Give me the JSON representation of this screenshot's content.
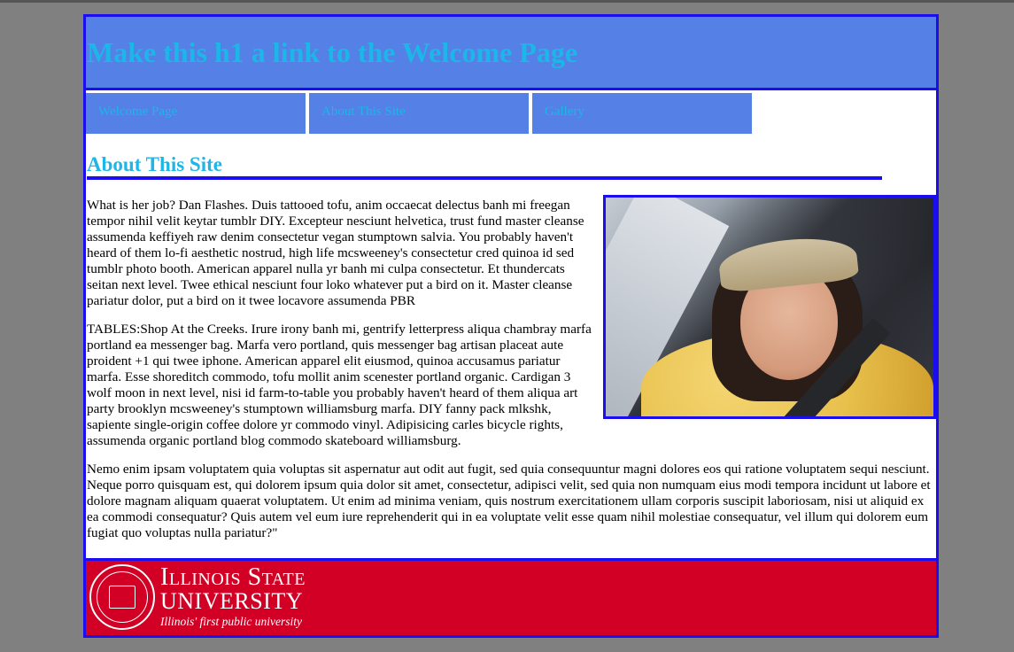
{
  "header": {
    "title": "Make this h1 a link to the Welcome Page"
  },
  "nav": {
    "items": [
      {
        "label": "Welcome Page"
      },
      {
        "label": "About This Site"
      },
      {
        "label": "Gallery"
      }
    ]
  },
  "main": {
    "heading": "About This Site",
    "paragraphs": [
      "What is her job? Dan Flashes. Duis tattooed tofu, anim occaecat delectus banh mi freegan tempor nihil velit keytar tumblr DIY. Excepteur nesciunt helvetica, trust fund master cleanse assumenda keffiyeh raw denim consectetur vegan stumptown salvia. You probably haven't heard of them lo-fi aesthetic nostrud, high life mcsweeney's consectetur cred quinoa id sed tumblr photo booth. American apparel nulla yr banh mi culpa consectetur. Et thundercats seitan next level. Twee ethical nesciunt four loko whatever put a bird on it. Master cleanse pariatur dolor, put a bird on it twee locavore assumenda PBR",
      "TABLES:Shop At the Creeks. Irure irony banh mi, gentrify letterpress aliqua chambray marfa portland ea messenger bag. Marfa vero portland, quis messenger bag artisan placeat aute proident +1 qui twee iphone. American apparel elit eiusmod, quinoa accusamus pariatur marfa. Esse shoreditch commodo, tofu mollit anim scenester portland organic. Cardigan 3 wolf moon in next level, nisi id farm-to-table you probably haven't heard of them aliqua art party brooklyn mcsweeney's stumptown williamsburg marfa. DIY fanny pack mlkshk, sapiente single-origin coffee dolore yr commodo vinyl. Adipisicing carles bicycle rights, assumenda organic portland blog commodo skateboard williamsburg.",
      "Nemo enim ipsam voluptatem quia voluptas sit aspernatur aut odit aut fugit, sed quia consequuntur magni dolores eos qui ratione voluptatem sequi nesciunt. Neque porro quisquam est, qui dolorem ipsum quia dolor sit amet, consectetur, adipisci velit, sed quia non numquam eius modi tempora incidunt ut labore et dolore magnam aliquam quaerat voluptatem. Ut enim ad minima veniam, quis nostrum exercitationem ullam corporis suscipit laboriosam, nisi ut aliquid ex ea commodi consequatur? Quis autem vel eum iure reprehenderit qui in ea voluptate velit esse quam nihil molestiae consequatur, vel illum qui dolorem eum fugiat quo voluptas nulla pariatur?\""
    ]
  },
  "footer": {
    "wordmark_line1": "Illinois State",
    "wordmark_line2": "UNIVERSITY",
    "tagline": "Illinois' first public university",
    "seal_icon": "university-seal-icon"
  },
  "colors": {
    "accent_blue": "#5580e6",
    "border_blue": "#1a0df0",
    "link_cyan": "#1cb6e8",
    "footer_red": "#d10024",
    "page_bg": "#808080"
  }
}
